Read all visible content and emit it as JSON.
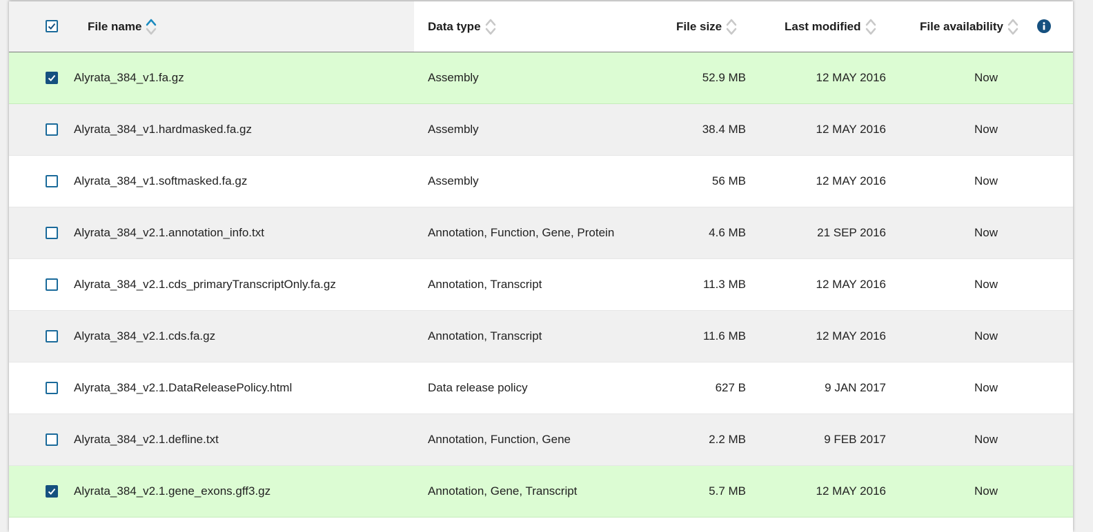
{
  "header": {
    "file_name": "File name",
    "data_type": "Data type",
    "file_size": "File size",
    "last_modified": "Last modified",
    "file_availability": "File availability"
  },
  "colors": {
    "accent": "#15507f",
    "selected_row": "#dcfcd3",
    "striped_row": "#f0f0f0",
    "sort_active": "#1a8abf",
    "sort_inactive": "#c8c8c8"
  },
  "rows": [
    {
      "name": "Alyrata_384_v1.fa.gz",
      "type": "Assembly",
      "size": "52.9 MB",
      "modified": "12 MAY 2016",
      "availability": "Now",
      "checked": true
    },
    {
      "name": "Alyrata_384_v1.hardmasked.fa.gz",
      "type": "Assembly",
      "size": "38.4 MB",
      "modified": "12 MAY 2016",
      "availability": "Now",
      "checked": false
    },
    {
      "name": "Alyrata_384_v1.softmasked.fa.gz",
      "type": "Assembly",
      "size": "56 MB",
      "modified": "12 MAY 2016",
      "availability": "Now",
      "checked": false
    },
    {
      "name": "Alyrata_384_v2.1.annotation_info.txt",
      "type": "Annotation, Function, Gene, Protein",
      "size": "4.6 MB",
      "modified": "21 SEP 2016",
      "availability": "Now",
      "checked": false
    },
    {
      "name": "Alyrata_384_v2.1.cds_primaryTranscriptOnly.fa.gz",
      "type": "Annotation, Transcript",
      "size": "11.3 MB",
      "modified": "12 MAY 2016",
      "availability": "Now",
      "checked": false
    },
    {
      "name": "Alyrata_384_v2.1.cds.fa.gz",
      "type": "Annotation, Transcript",
      "size": "11.6 MB",
      "modified": "12 MAY 2016",
      "availability": "Now",
      "checked": false
    },
    {
      "name": "Alyrata_384_v2.1.DataReleasePolicy.html",
      "type": "Data release policy",
      "size": "627 B",
      "modified": "9 JAN 2017",
      "availability": "Now",
      "checked": false
    },
    {
      "name": "Alyrata_384_v2.1.defline.txt",
      "type": "Annotation, Function, Gene",
      "size": "2.2 MB",
      "modified": "9 FEB 2017",
      "availability": "Now",
      "checked": false
    },
    {
      "name": "Alyrata_384_v2.1.gene_exons.gff3.gz",
      "type": "Annotation, Gene, Transcript",
      "size": "5.7 MB",
      "modified": "12 MAY 2016",
      "availability": "Now",
      "checked": true
    }
  ]
}
